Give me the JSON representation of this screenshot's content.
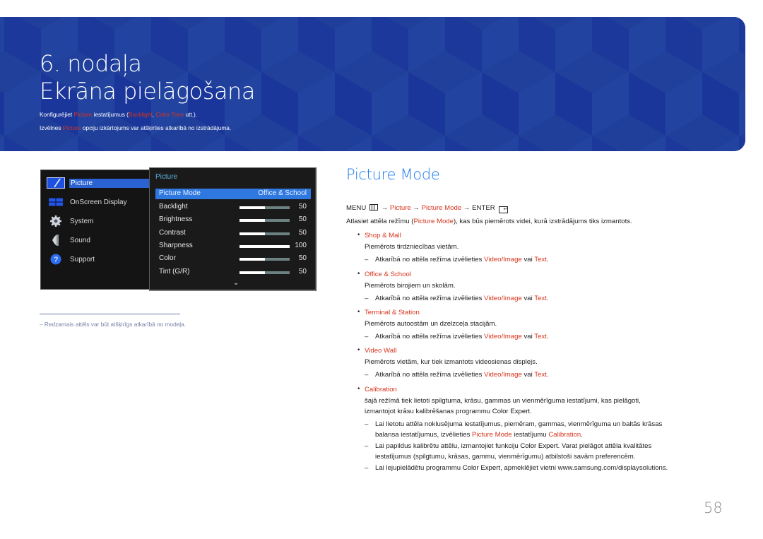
{
  "banner": {
    "chapter_number": "6. nodaļa",
    "chapter_title": "Ekrāna pielāgošana",
    "line1": [
      {
        "t": "Konfigurējiet ",
        "hl": false
      },
      {
        "t": "Picture",
        "hl": true
      },
      {
        "t": " iestatījumus (",
        "hl": false
      },
      {
        "t": "Backlight",
        "hl": true
      },
      {
        "t": ", ",
        "hl": false
      },
      {
        "t": "Color Tone",
        "hl": true
      },
      {
        "t": " utt.).",
        "hl": false
      }
    ],
    "line2": [
      {
        "t": "Izvēlnes ",
        "hl": false
      },
      {
        "t": "Picture",
        "hl": true
      },
      {
        "t": " opciju izkārtojums var atšķirties atkarībā no izstrādājuma.",
        "hl": false
      }
    ],
    "colors": {
      "background": "#1f3f9a",
      "highlight": "#d6341c"
    }
  },
  "osd": {
    "main_menu": [
      {
        "label": "Picture",
        "icon": "picture-icon",
        "active": true
      },
      {
        "label": "OnScreen Display",
        "icon": "onscreen-display-icon",
        "active": false
      },
      {
        "label": "System",
        "icon": "gear-icon",
        "active": false
      },
      {
        "label": "Sound",
        "icon": "speaker-icon",
        "active": false
      },
      {
        "label": "Support",
        "icon": "help-icon",
        "active": false
      }
    ],
    "submenu_title": "Picture",
    "picture_mode": {
      "label": "Picture Mode",
      "value": "Office & School"
    },
    "sliders": [
      {
        "label": "Backlight",
        "value": "50",
        "fraction": 0.5
      },
      {
        "label": "Brightness",
        "value": "50",
        "fraction": 0.5
      },
      {
        "label": "Contrast",
        "value": "50",
        "fraction": 0.5
      },
      {
        "label": "Sharpness",
        "value": "100",
        "fraction": 1.0
      },
      {
        "label": "Color",
        "value": "50",
        "fraction": 0.5
      },
      {
        "label": "Tint (G/R)",
        "value": "50",
        "fraction": 0.5
      }
    ],
    "more_indicator": "⌄"
  },
  "footnote": "–  Redzamais attēls var būt atšķirīgs atkarībā no modeļa.",
  "section": {
    "title": "Picture Mode",
    "menu_path": {
      "menu": "MENU",
      "arrow": " → ",
      "picture": "Picture",
      "picture_mode": "Picture Mode",
      "enter": "ENTER"
    },
    "intro_before": "Atlasiet attēla režīmu (",
    "intro_hl": "Picture Mode",
    "intro_after": "), kas būs piemērots videi, kurā izstrādājums tiks izmantots.",
    "items": [
      {
        "name": "Shop & Mall",
        "desc": "Piemērots tirdzniecības vietām."
      },
      {
        "name": "Office & School",
        "desc": "Piemērots birojiem un skolām."
      },
      {
        "name": "Terminal & Station",
        "desc": "Piemērots autoostām un dzelzceļa stacijām."
      },
      {
        "name": "Video Wall",
        "desc": "Piemērots vietām, kur tiek izmantots videosienas displejs."
      }
    ],
    "common_note": {
      "before": "Atkarībā no attēla režīma izvēlieties ",
      "hl1": "Video/Image",
      "mid": " vai ",
      "hl2": "Text",
      "after": "."
    },
    "calibration": {
      "name": "Calibration",
      "desc1": "šajā režīmā tiek lietoti spilgtuma, krāsu, gammas un vienmērīguma iestatījumi, kas pielāgoti,",
      "desc2_before": "izmantojot krāsu kalibrēšanas programmu ",
      "desc2_b": "Color Expert",
      "desc2_after": ".",
      "note1_l1": "Lai lietotu attēla noklusējuma iestatījumus, piemēram, gammas, vienmērīguma un baltās krāsas",
      "note1_l2_before": "balansa iestatījumus, izvēlieties ",
      "note1_l2_hl1": "Picture Mode",
      "note1_l2_mid": " iestatījumu ",
      "note1_l2_hl2": "Calibration",
      "note1_l2_after": ".",
      "note2_l1_before": "Lai papildus kalibrētu attēlu, izmantojiet funkciju ",
      "note2_l1_b": "Color Expert",
      "note2_l1_after": ". Varat pielāgot attēla kvalitātes",
      "note2_l2": "iestatījumus (spilgtumu, krāsas, gammu, vienmērīgumu) atbilstoši savām preferencēm.",
      "note3_before": "Lai lejupielādētu programmu ",
      "note3_b": "Color Expert",
      "note3_after": ", apmeklējiet vietni www.samsung.com/displaysolutions."
    },
    "dash": "–",
    "bullet": "•"
  },
  "page_number": "58"
}
